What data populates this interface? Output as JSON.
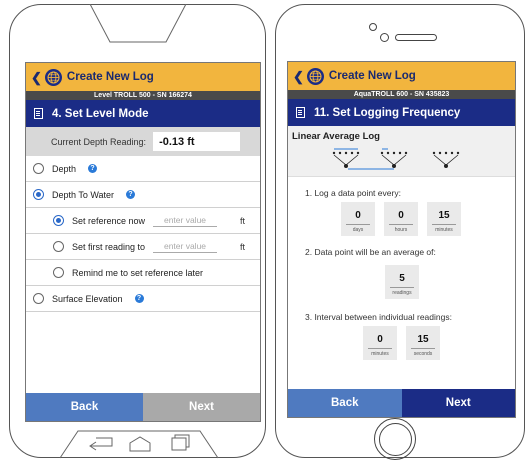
{
  "android": {
    "nav": {
      "back_chevron": "❮",
      "title": "Create New Log"
    },
    "device": "Level TROLL 500 - SN 166274",
    "step_title": "4. Set Level Mode",
    "depth": {
      "label": "Current Depth Reading:",
      "value": "-0.13 ft"
    },
    "help_glyph": "?",
    "options": [
      {
        "label": "Depth",
        "selected": false,
        "help": true
      },
      {
        "label": "Depth To Water",
        "selected": true,
        "help": true
      }
    ],
    "sub_options": [
      {
        "label": "Set reference now",
        "selected": true,
        "placeholder": "enter value",
        "unit": "ft"
      },
      {
        "label": "Set first reading to",
        "selected": false,
        "placeholder": "enter value",
        "unit": "ft"
      },
      {
        "label": "Remind me to set reference later",
        "selected": false
      }
    ],
    "last_option": {
      "label": "Surface Elevation",
      "selected": false,
      "help": true
    },
    "footer": {
      "back": "Back",
      "next": "Next"
    },
    "colors": {
      "back_bg": "#4f7ac0",
      "next_bg": "#a9a9a9"
    }
  },
  "iphone": {
    "nav": {
      "back_chevron": "❮",
      "title": "Create New Log"
    },
    "device": "AquaTROLL 600 - SN 435823",
    "step_title": "11. Set Logging Frequency",
    "section": "Linear Average Log",
    "q1": "1. Log a data point every:",
    "q1_cells": [
      {
        "value": "0",
        "unit": "days"
      },
      {
        "value": "0",
        "unit": "hours"
      },
      {
        "value": "15",
        "unit": "minutes"
      }
    ],
    "q2": "2. Data point will be an average of:",
    "q2_cells": [
      {
        "value": "5",
        "unit": "readings"
      }
    ],
    "q3": "3. Interval between individual readings:",
    "q3_cells": [
      {
        "value": "0",
        "unit": "minutes"
      },
      {
        "value": "15",
        "unit": "seconds"
      }
    ],
    "footer": {
      "back": "Back",
      "next": "Next"
    },
    "colors": {
      "back_bg": "#4f7ac0",
      "next_bg": "#1b2c86"
    }
  },
  "colors": {
    "topbar": "#f2b53e",
    "header": "#1b2c86",
    "accent": "#2a68c8"
  }
}
